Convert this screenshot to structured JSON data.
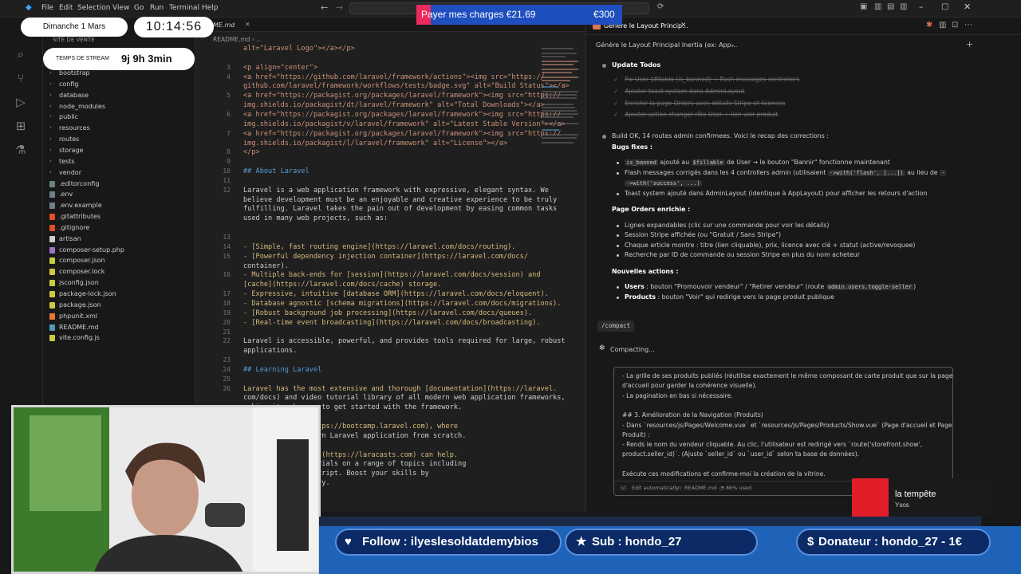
{
  "menu": [
    "File",
    "Edit",
    "Selection",
    "View",
    "Go",
    "Run",
    "Terminal",
    "Help"
  ],
  "overlay": {
    "date": "Dimanche 1 Mars",
    "time": "10:14:56",
    "stream_label": "TEMPS DE STREAM",
    "stream_time": "9j 9h 3min",
    "charges_label": "Payer mes charges €21.69",
    "charges_goal": "€300",
    "alert_name": "la tempête",
    "alert_sub": "Ysos",
    "follow": "Follow : ilyeslesoldatdemybios",
    "sub": "Sub : hondo_27",
    "donateur": "Donateur : hondo_27 - 1€"
  },
  "explorer": {
    "header": "SITE DE VENTE",
    "items": [
      {
        "label": "bootstrap",
        "type": "folder"
      },
      {
        "label": "config",
        "type": "folder"
      },
      {
        "label": "database",
        "type": "folder"
      },
      {
        "label": "node_modules",
        "type": "folder"
      },
      {
        "label": "public",
        "type": "folder"
      },
      {
        "label": "resources",
        "type": "folder"
      },
      {
        "label": "routes",
        "type": "folder"
      },
      {
        "label": "storage",
        "type": "folder"
      },
      {
        "label": "tests",
        "type": "folder"
      },
      {
        "label": "vendor",
        "type": "folder"
      },
      {
        "label": ".editorconfig",
        "type": "gear"
      },
      {
        "label": ".env",
        "type": "gear"
      },
      {
        "label": ".env.example",
        "type": "gear"
      },
      {
        "label": ".gitattributes",
        "type": "git"
      },
      {
        "label": ".gitignore",
        "type": "git"
      },
      {
        "label": "artisan",
        "type": "file"
      },
      {
        "label": "composer-setup.php",
        "type": "php"
      },
      {
        "label": "composer.json",
        "type": "json"
      },
      {
        "label": "composer.lock",
        "type": "json"
      },
      {
        "label": "jsconfig.json",
        "type": "json"
      },
      {
        "label": "package-lock.json",
        "type": "json"
      },
      {
        "label": "package.json",
        "type": "json"
      },
      {
        "label": "phpunit.xml",
        "type": "xml"
      },
      {
        "label": "README.md",
        "type": "md"
      },
      {
        "label": "vite.config.js",
        "type": "js"
      }
    ]
  },
  "editor": {
    "tab1": "ME.md",
    "breadcrumb": "README.md  ›  ..."
  },
  "chat": {
    "tab_title": "Génère le Layout Princip...",
    "session_title": "Génère le Layout Principal Inertia (ex: App...",
    "update_todos": "Update Todos",
    "todos": [
      "Fix User $fillable (is_banned) + flash messages controllers",
      "Ajouter toast system dans AdminLayout",
      "Enrichir la page Orders avec détails Stripe et licences",
      "Ajouter action changer rôle User + lien voir produit"
    ],
    "summary": "Build OK, 14 routes admin confirmees. Voici le recap des corrections :",
    "bugs_title": "Bugs fixes :",
    "bug1_a": "is_banned",
    "bug1_b": "ajouté au",
    "bug1_c": "$fillable",
    "bug1_d": "de User → le bouton \"Bannir\" fonctionne maintenant",
    "bug2_a": "Flash messages corrigés dans les 4 controllers admin (utilisaient",
    "bug2_b": "->with('flash', [...])",
    "bug2_c": "au lieu de",
    "bug2_d": "->with('success', ...)",
    "bug3": "Toast system ajouté dans AdminLayout (identique à AppLayout) pour afficher les retours d'action",
    "orders_title": "Page Orders enrichie :",
    "orders": [
      "Lignes expandables (clic sur une commande pour voir les détails)",
      "Session Stripe affichée (ou \"Gratuit / Sans Stripe\")",
      "Chaque article montre : titre (lien cliquable), prix, licence avec clé + statut (active/revoquee)",
      "Recherche par ID de commande ou session Stripe en plus du nom acheteur"
    ],
    "actions_title": "Nouvelles actions :",
    "act1_b": "Users",
    "act1": ": bouton \"Promouvoir vendeur\" / \"Retirer vendeur\" (route",
    "act1_code": "admin.users.toggle-seller",
    "act2_b": "Products",
    "act2": ": bouton \"Voir\" qui redirige vers la page produit publique",
    "compact_cmd": "/compact",
    "compacting": "Compacting...",
    "input_lines": [
      "- La grille de ses produits publiés (réutilise exactement le même composant de carte produit que sur la page",
      "d'accueil pour garder la cohérence visuelle).",
      "- La pagination en bas si nécessaire.",
      "",
      "## 3. Amélioration de la Navigation (Produits)",
      "- Dans `resources/js/Pages/Welcome.vue` et `resources/js/Pages/Products/Show.vue` (Page d'accueil et Page",
      "Produit) :",
      "- Rends le nom du vendeur cliquable. Au clic, l'utilisateur est redirigé vers `route('storefront.show',",
      "product.seller_id)`. (Ajuste `seller_id` ou `user_id` selon ta base de données).",
      "",
      "Exécute ces modifications et confirme-moi la création de la vitrine."
    ],
    "footer_edit": "Edit automatically",
    "footer_file": "README.md",
    "footer_pct": "86% used"
  },
  "code_lines": [
    {
      "n": "",
      "t": "alt=\"Laravel Logo\"></a></p>"
    },
    {
      "n": "",
      "t": ""
    },
    {
      "n": "3",
      "t": "<p align=\"center\">"
    },
    {
      "n": "4",
      "t": "<a href=\"https://github.com/laravel/framework/actions\"><img src=\"https://"
    },
    {
      "n": "",
      "t": "github.com/laravel/framework/workflows/tests/badge.svg\" alt=\"Build Status\"></a>"
    },
    {
      "n": "5",
      "t": "<a href=\"https://packagist.org/packages/laravel/framework\"><img src=\"https://"
    },
    {
      "n": "",
      "t": "img.shields.io/packagist/dt/laravel/framework\" alt=\"Total Downloads\"></a>"
    },
    {
      "n": "6",
      "t": "<a href=\"https://packagist.org/packages/laravel/framework\"><img src=\"https://"
    },
    {
      "n": "",
      "t": "img.shields.io/packagist/v/laravel/framework\" alt=\"Latest Stable Version\"></a>"
    },
    {
      "n": "7",
      "t": "<a href=\"https://packagist.org/packages/laravel/framework\"><img src=\"https://"
    },
    {
      "n": "",
      "t": "img.shields.io/packagist/l/laravel/framework\" alt=\"License\"></a>"
    },
    {
      "n": "8",
      "t": "</p>"
    },
    {
      "n": "9",
      "t": ""
    },
    {
      "n": "10",
      "t": "## About Laravel"
    },
    {
      "n": "11",
      "t": ""
    },
    {
      "n": "12",
      "t": "Laravel is a web application framework with expressive, elegant syntax. We"
    },
    {
      "n": "",
      "t": "believe development must be an enjoyable and creative experience to be truly"
    },
    {
      "n": "",
      "t": "fulfilling. Laravel takes the pain out of development by easing common tasks"
    },
    {
      "n": "",
      "t": "used in many web projects, such as:"
    },
    {
      "n": "",
      "t": ""
    },
    {
      "n": "13",
      "t": ""
    },
    {
      "n": "14",
      "t": "- [Simple, fast routing engine](https://laravel.com/docs/routing)."
    },
    {
      "n": "15",
      "t": "- [Powerful dependency injection container](https://laravel.com/docs/"
    },
    {
      "n": "",
      "t": "container)."
    },
    {
      "n": "16",
      "t": "- Multiple back-ends for [session](https://laravel.com/docs/session) and"
    },
    {
      "n": "",
      "t": "[cache](https://laravel.com/docs/cache) storage."
    },
    {
      "n": "17",
      "t": "- Expressive, intuitive [database ORM](https://laravel.com/docs/eloquent)."
    },
    {
      "n": "18",
      "t": "- Database agnostic [schema migrations](https://laravel.com/docs/migrations)."
    },
    {
      "n": "19",
      "t": "- [Robust background job processing](https://laravel.com/docs/queues)."
    },
    {
      "n": "20",
      "t": "- [Real-time event broadcasting](https://laravel.com/docs/broadcasting)."
    },
    {
      "n": "21",
      "t": ""
    },
    {
      "n": "22",
      "t": "Laravel is accessible, powerful, and provides tools required for large, robust"
    },
    {
      "n": "",
      "t": "applications."
    },
    {
      "n": "23",
      "t": ""
    },
    {
      "n": "24",
      "t": "## Learning Laravel"
    },
    {
      "n": "25",
      "t": ""
    },
    {
      "n": "26",
      "t": "Laravel has the most extensive and thorough [documentation](https://laravel."
    },
    {
      "n": "",
      "t": "com/docs) and video tutorial library of all modern web application frameworks,"
    },
    {
      "n": "",
      "t": "making it a breeze to get started with the framework."
    },
    {
      "n": "",
      "t": ""
    },
    {
      "n": "",
      "t": "ravel Bootcamp](https://bootcamp.laravel.com), where"
    },
    {
      "n": "",
      "t": "gh building a modern Laravel application from scratch."
    },
    {
      "n": "",
      "t": ""
    },
    {
      "n": "",
      "t": "eading, [Laracasts](https://laracasts.com) can help."
    },
    {
      "n": "",
      "t": "ands of video tutorials on a range of topics including"
    },
    {
      "n": "",
      "t": "testing, and JavaScript. Boost your skills by"
    },
    {
      "n": "",
      "t": "ensive video library."
    }
  ]
}
